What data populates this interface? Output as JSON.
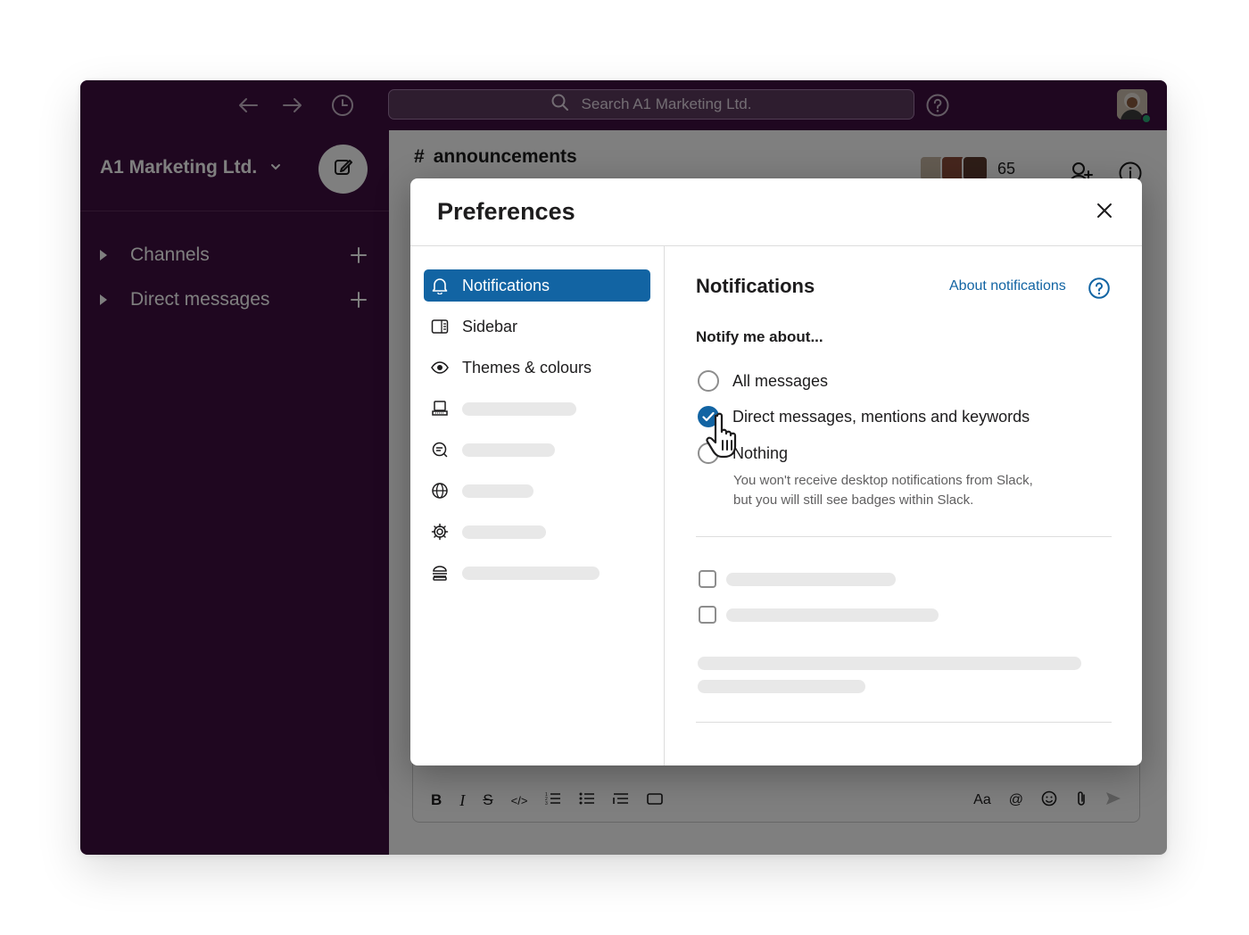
{
  "topbar": {
    "search_placeholder": "Search A1 Marketing Ltd."
  },
  "sidebar": {
    "workspace_name": "A1 Marketing Ltd.",
    "sections": [
      {
        "label": "Channels"
      },
      {
        "label": "Direct messages"
      }
    ]
  },
  "channel": {
    "title": "announcements",
    "member_count": "65"
  },
  "composer": {
    "aa_label": "Aa"
  },
  "modal": {
    "title": "Preferences",
    "nav": [
      {
        "label": "Notifications",
        "icon": "bell-icon",
        "active": true
      },
      {
        "label": "Sidebar",
        "icon": "sidebar-icon"
      },
      {
        "label": "Themes & colours",
        "icon": "eye-icon"
      }
    ],
    "pane": {
      "title": "Notifications",
      "about_link": "About notifications",
      "notify_label": "Notify me about...",
      "options": [
        {
          "label": "All messages",
          "checked": false
        },
        {
          "label": "Direct messages, mentions and keywords",
          "checked": true
        },
        {
          "label": "Nothing",
          "checked": false
        }
      ],
      "hint_line1": "You won't receive desktop notifications from Slack,",
      "hint_line2": "but you will still see badges within Slack."
    }
  },
  "colors": {
    "aubergine": "#3f0e40",
    "selected_blue": "#1264a3",
    "link_blue": "#1264a3",
    "online_green": "#2bac76"
  }
}
